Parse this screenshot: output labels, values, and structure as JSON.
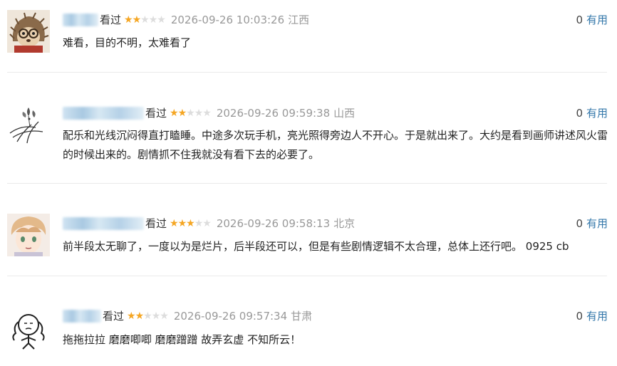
{
  "reviews": [
    {
      "watched_label": "看过",
      "rating": 2,
      "time": "2026-09-26 10:03:26",
      "region": "江西",
      "useful_count": "0",
      "useful_label": "有用",
      "content": "难看，目的不明，太难看了"
    },
    {
      "watched_label": "看过",
      "rating": 2,
      "time": "2026-09-26 09:59:38",
      "region": "山西",
      "useful_count": "0",
      "useful_label": "有用",
      "content": "配乐和光线沉闷得直打瞌睡。中途多次玩手机，亮光照得旁边人不开心。于是就出来了。大约是看到画师讲述风火雷的时候出来的。剧情抓不住我就没有看下去的必要了。"
    },
    {
      "watched_label": "看过",
      "rating": 3,
      "time": "2026-09-26 09:58:13",
      "region": "北京",
      "useful_count": "0",
      "useful_label": "有用",
      "content": "前半段太无聊了，一度以为是烂片，后半段还可以，但是有些剧情逻辑不太合理，总体上还行吧。 0925 cb"
    },
    {
      "watched_label": "看过",
      "rating": 2,
      "time": "2026-09-26 09:57:34",
      "region": "甘肃",
      "useful_count": "0",
      "useful_label": "有用",
      "content": "拖拖拉拉 磨磨唧唧 磨磨蹭蹭 故弄玄虚 不知所云！"
    }
  ],
  "colors": {
    "star_on": "#f5a623",
    "star_off": "#dddddd",
    "link": "#3377aa",
    "meta_gray": "#999999"
  },
  "icons": {
    "avatar_1": "hedgehog-with-glasses",
    "avatar_2": "orchid-ink-drawing",
    "avatar_3": "anime-boy",
    "avatar_4": "line-drawn-girl"
  }
}
